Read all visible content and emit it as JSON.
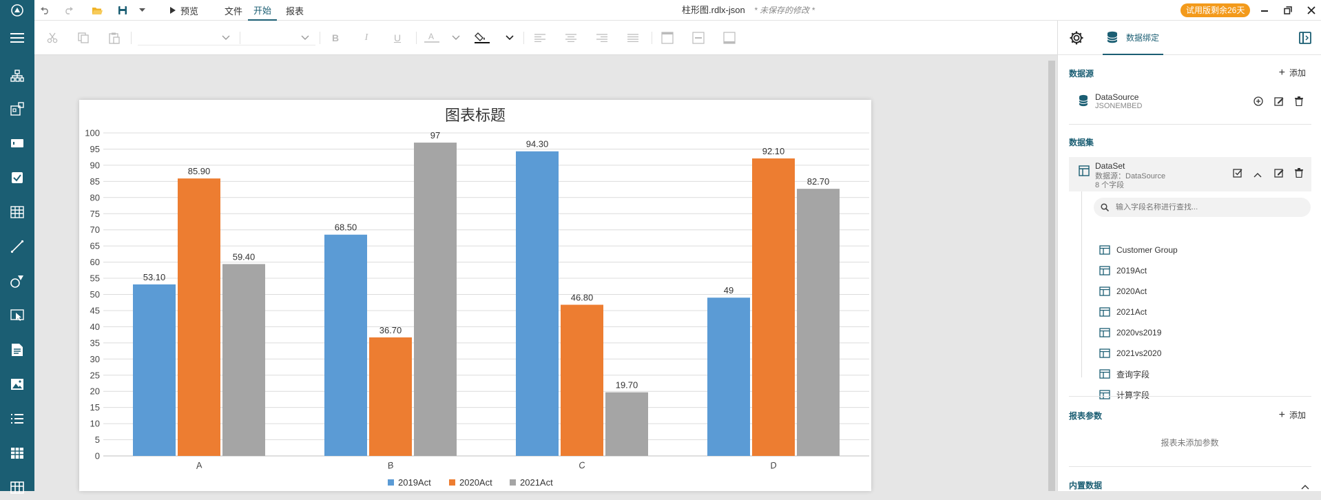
{
  "app": {
    "doc_title": "柱形图.rdlx-json",
    "doc_status": "* 未保存的修改 *",
    "trial_badge": "试用版剩余26天"
  },
  "topbar": {
    "preview_label": "预览",
    "menus": [
      "文件",
      "开始",
      "报表"
    ],
    "active_menu": "开始"
  },
  "sidebar_icons": [
    "menu-icon",
    "tree-icon",
    "group-icon",
    "textbox-icon",
    "checkbox-icon",
    "table-icon",
    "line-icon",
    "shape-icon",
    "select-icon",
    "document-icon",
    "image-icon",
    "list-icon",
    "grid-icon",
    "matrix-icon"
  ],
  "toolbar_icons": [
    "cut-icon",
    "copy-icon",
    "paste-icon",
    "bold-icon",
    "italic-icon",
    "underline-icon",
    "font-color-icon",
    "fill-color-icon",
    "align-left-icon",
    "align-center-icon",
    "align-right-icon",
    "justify-icon",
    "border-top-icon",
    "border-middle-icon",
    "border-bottom-icon"
  ],
  "right_panel": {
    "active_tab": "数据绑定",
    "datasource_title": "数据源",
    "add_label": "添加",
    "datasource": {
      "name": "DataSource",
      "type": "JSONEMBED"
    },
    "dataset_title": "数据集",
    "dataset": {
      "name": "DataSet",
      "source": "数据源：DataSource",
      "fields_count": "8 个字段"
    },
    "search_placeholder": "输入字段名称进行查找...",
    "fields": [
      "Customer Group",
      "2019Act",
      "2020Act",
      "2021Act",
      "2020vs2019",
      "2021vs2020",
      "查询字段",
      "计算字段"
    ],
    "params_title": "报表参数",
    "params_empty": "报表未添加参数",
    "embedded_title": "内置数据"
  },
  "chart_data": {
    "type": "bar",
    "title": "图表标题",
    "categories": [
      "A",
      "B",
      "C",
      "D"
    ],
    "series": [
      {
        "name": "2019Act",
        "values": [
          53.1,
          68.5,
          94.3,
          49
        ],
        "labels": [
          "53.10",
          "68.50",
          "94.30",
          "49"
        ],
        "color": "#5b9bd5"
      },
      {
        "name": "2020Act",
        "values": [
          85.9,
          36.7,
          46.8,
          92.1
        ],
        "labels": [
          "85.90",
          "36.70",
          "46.80",
          "92.10"
        ],
        "color": "#ed7d31"
      },
      {
        "name": "2021Act",
        "values": [
          59.4,
          97,
          19.7,
          82.7
        ],
        "labels": [
          "59.40",
          "97",
          "19.70",
          "82.70"
        ],
        "color": "#a5a5a5"
      }
    ],
    "ylim": [
      0,
      100
    ],
    "ytick_step": 5,
    "grid": true,
    "legend_position": "bottom"
  }
}
